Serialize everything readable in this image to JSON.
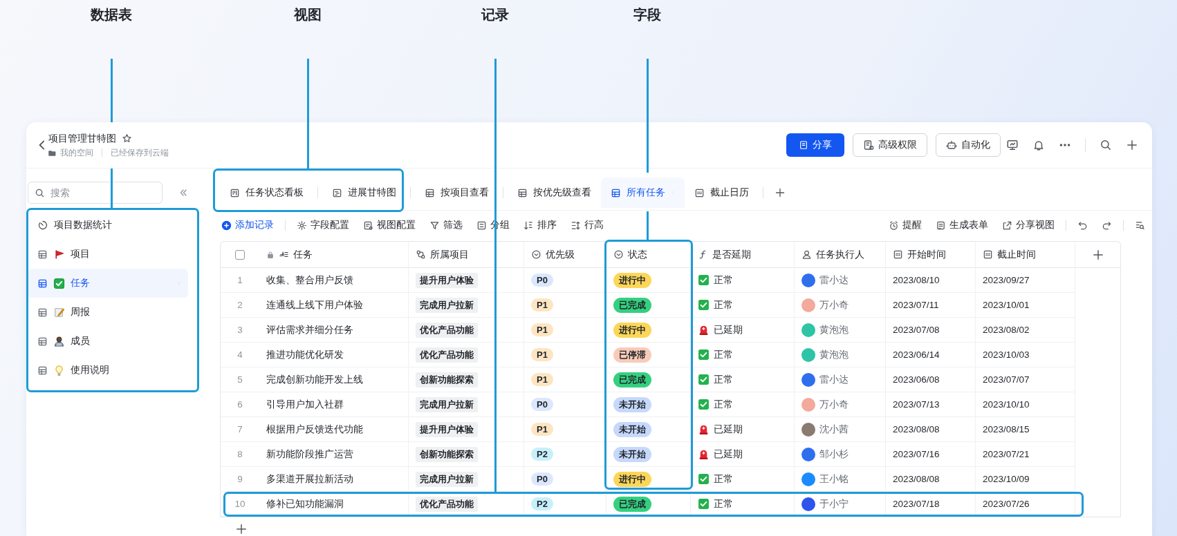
{
  "annotations": [
    {
      "label": "数据表"
    },
    {
      "label": "视图"
    },
    {
      "label": "记录"
    },
    {
      "label": "字段"
    }
  ],
  "header": {
    "title": "项目管理甘特图",
    "breadcrumb": "我的空间",
    "save_status": "已经保存到云端",
    "share_button": "分享",
    "buttons": [
      "高级权限",
      "自动化"
    ]
  },
  "sidebar": {
    "search": {
      "placeholder": "搜索"
    },
    "dashboard": {
      "label": "项目数据统计"
    },
    "tables": [
      {
        "label": "项目",
        "selected": false
      },
      {
        "label": "任务",
        "selected": true
      },
      {
        "label": "周报",
        "selected": false
      },
      {
        "label": "成员",
        "selected": false
      },
      {
        "label": "使用说明",
        "selected": false
      }
    ]
  },
  "view_tabs": [
    {
      "label": "任务状态看板",
      "selected": false
    },
    {
      "label": "进展甘特图",
      "selected": false
    },
    {
      "label": "按项目查看",
      "selected": false
    },
    {
      "label": "按优先级查看",
      "selected": false
    },
    {
      "label": "所有任务",
      "selected": true
    },
    {
      "label": "截止日历",
      "selected": false
    }
  ],
  "toolbar": {
    "add_record": "添加记录",
    "left": [
      "字段配置",
      "视图配置",
      "筛选",
      "分组",
      "排序",
      "行高"
    ],
    "right": [
      "提醒",
      "生成表单",
      "分享视图"
    ]
  },
  "table": {
    "select_all": {
      "checked": false
    },
    "columns": [
      "任务",
      "所属项目",
      "优先级",
      "状态",
      "是否延期",
      "任务执行人",
      "开始时间",
      "截止时间"
    ],
    "rows": [
      {
        "number": "1",
        "task": "收集、整合用户反馈",
        "project": "提升用户体验",
        "priority": {
          "text": "P0",
          "color": "#dbe7fd"
        },
        "status": {
          "text": "进行中",
          "color": "#fcd659"
        },
        "delayed": false,
        "delay_label": "正常",
        "assignee": {
          "name": "雷小达",
          "color": "#2f6fed"
        },
        "start": "2023/08/10",
        "end": "2023/09/27"
      },
      {
        "number": "2",
        "task": "连通线上线下用户体验",
        "project": "完成用户拉新",
        "priority": {
          "text": "P1",
          "color": "#fde5c2"
        },
        "status": {
          "text": "已完成",
          "color": "#34d07f"
        },
        "delayed": false,
        "delay_label": "正常",
        "assignee": {
          "name": "万小奇",
          "color": "#f3a99c"
        },
        "start": "2023/07/11",
        "end": "2023/10/01"
      },
      {
        "number": "3",
        "task": "评估需求并细分任务",
        "project": "优化产品功能",
        "priority": {
          "text": "P1",
          "color": "#fde5c2"
        },
        "status": {
          "text": "进行中",
          "color": "#fcd659"
        },
        "delayed": true,
        "delay_label": "已延期",
        "assignee": {
          "name": "黄泡泡",
          "color": "#2ec4a6"
        },
        "start": "2023/07/08",
        "end": "2023/08/02"
      },
      {
        "number": "4",
        "task": "推进功能优化研发",
        "project": "优化产品功能",
        "priority": {
          "text": "P1",
          "color": "#fde5c2"
        },
        "status": {
          "text": "已停滞",
          "color": "#f8cbb8"
        },
        "delayed": false,
        "delay_label": "正常",
        "assignee": {
          "name": "黄泡泡",
          "color": "#2ec4a6"
        },
        "start": "2023/06/14",
        "end": "2023/10/03"
      },
      {
        "number": "5",
        "task": "完成创新功能开发上线",
        "project": "创新功能探索",
        "priority": {
          "text": "P1",
          "color": "#fde5c2"
        },
        "status": {
          "text": "已完成",
          "color": "#34d07f"
        },
        "delayed": false,
        "delay_label": "正常",
        "assignee": {
          "name": "雷小达",
          "color": "#2f6fed"
        },
        "start": "2023/06/08",
        "end": "2023/07/07"
      },
      {
        "number": "6",
        "task": "引导用户加入社群",
        "project": "完成用户拉新",
        "priority": {
          "text": "P0",
          "color": "#dbe7fd"
        },
        "status": {
          "text": "未开始",
          "color": "#c6d8fb"
        },
        "delayed": false,
        "delay_label": "正常",
        "assignee": {
          "name": "万小奇",
          "color": "#f3a99c"
        },
        "start": "2023/07/13",
        "end": "2023/10/10"
      },
      {
        "number": "7",
        "task": "根据用户反馈迭代功能",
        "project": "提升用户体验",
        "priority": {
          "text": "P1",
          "color": "#fde5c2"
        },
        "status": {
          "text": "未开始",
          "color": "#c6d8fb"
        },
        "delayed": true,
        "delay_label": "已延期",
        "assignee": {
          "name": "沈小茜",
          "color": "#8a7a70"
        },
        "start": "2023/08/08",
        "end": "2023/08/15"
      },
      {
        "number": "8",
        "task": "新功能阶段推广运营",
        "project": "创新功能探索",
        "priority": {
          "text": "P2",
          "color": "#c7f0fb"
        },
        "status": {
          "text": "未开始",
          "color": "#c6d8fb"
        },
        "delayed": true,
        "delay_label": "已延期",
        "assignee": {
          "name": "邹小杉",
          "color": "#2f6fed"
        },
        "start": "2023/07/16",
        "end": "2023/07/21"
      },
      {
        "number": "9",
        "task": "多渠道开展拉新活动",
        "project": "完成用户拉新",
        "priority": {
          "text": "P0",
          "color": "#dbe7fd"
        },
        "status": {
          "text": "进行中",
          "color": "#fcd659"
        },
        "delayed": false,
        "delay_label": "正常",
        "assignee": {
          "name": "王小铭",
          "color": "#1a8cff"
        },
        "start": "2023/08/08",
        "end": "2023/10/09"
      },
      {
        "number": "10",
        "task": "修补已知功能漏洞",
        "project": "优化产品功能",
        "priority": {
          "text": "P2",
          "color": "#c7f0fb"
        },
        "status": {
          "text": "已完成",
          "color": "#34d07f"
        },
        "delayed": false,
        "delay_label": "正常",
        "assignee": {
          "name": "于小宁",
          "color": "#2f54eb"
        },
        "start": "2023/07/18",
        "end": "2023/07/26"
      }
    ]
  }
}
